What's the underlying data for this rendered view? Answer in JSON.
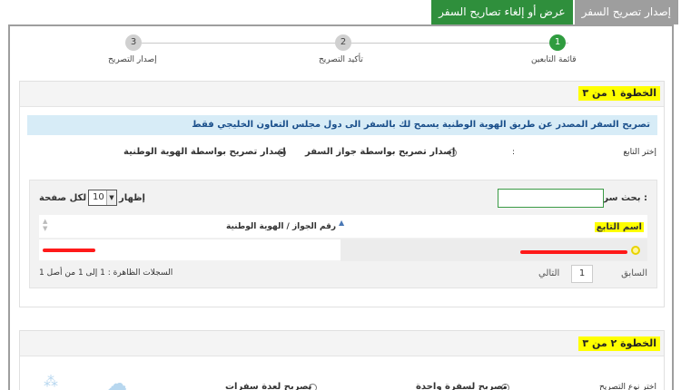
{
  "tabs": [
    {
      "label": "إصدار تصريح السفر",
      "active": false
    },
    {
      "label": "عرض أو إلغاء تصاريح السفر",
      "active": true
    }
  ],
  "stepper": [
    {
      "num": "1",
      "label": "قائمة التابعين",
      "status": "done"
    },
    {
      "num": "2",
      "label": "تأكيد التصريح",
      "status": "todo"
    },
    {
      "num": "3",
      "label": "إصدار التصريح",
      "status": "todo"
    }
  ],
  "step1": {
    "title": "الخطوة ١ من ٣",
    "info": "تصريح السفر المصدر عن طريق الهوية الوطنية يسمح لك بالسفر الى دول مجلس التعاون الخليجي فقط",
    "select_label": "إختر التابع",
    "colon": ":",
    "option_passport": "إصدار تصريح بواسطة جواز السفر",
    "option_national_id": "إصدار تصريح بواسطة الهوية الوطنية",
    "selected_option": "national_id",
    "table": {
      "search_label": "بحث سريع :",
      "show_label": "إظهار",
      "page_size": "10",
      "per_page_label": "لكل صفحة",
      "columns": [
        "اسم التابع",
        "رقم الجواز / الهوية الوطنية"
      ],
      "pagination_info": "السجلات الظاهرة : 1 إلى 1 من أصل 1",
      "prev": "السابق",
      "page": "1",
      "next": "التالي"
    }
  },
  "step2": {
    "title": "الخطوة ٢ من ٣",
    "select_label": "اختر نوع التصريح",
    "option_single": "تصريح لسفرة واحدة",
    "option_multi": "تصريح لعدة سفرات",
    "selected_option": "single"
  },
  "colors": {
    "tab_active": "#2f8f3c",
    "tab_inactive": "#9e9e9e",
    "step_done": "#2f9c3f",
    "highlight": "#ffff00",
    "info_bg": "#d7ecf7",
    "info_text": "#1a4f8b"
  }
}
